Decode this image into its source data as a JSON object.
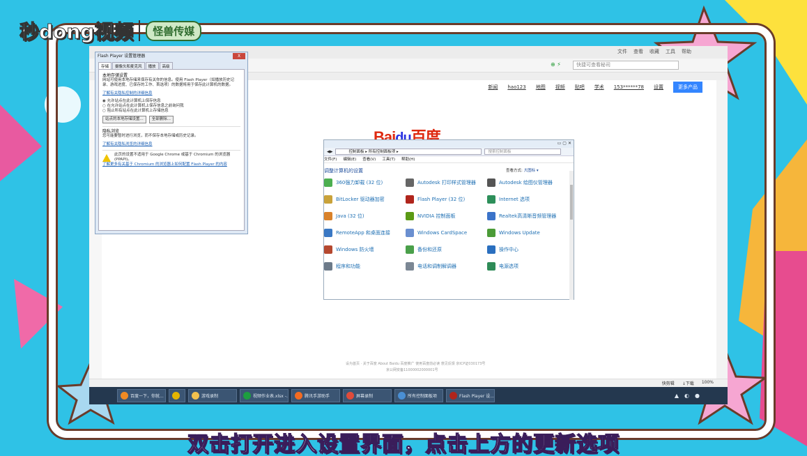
{
  "brand": {
    "name": "秒dong视频",
    "partner": "怪兽传媒"
  },
  "subtitle": "双击打开进入设置界面，点击上方的更新选项",
  "browser": {
    "window_menu": [
      "文件",
      "查看",
      "收藏",
      "工具",
      "帮助"
    ],
    "search_placeholder": "快捷可查看秘司",
    "nav_links": [
      "新闻",
      "hao123",
      "地图",
      "视频",
      "贴吧",
      "学术",
      "153******78",
      "设置"
    ],
    "more_button": "更多产品",
    "logo_left": "Bai",
    "logo_paw": "du",
    "logo_right": "百度",
    "footer_line1": "设为首页 · 关于百度 About Baidu 百度推广 使用百度前必读 意见反馈 京ICP证030173号",
    "footer_line2": "京公网安备11000002000001号",
    "status_items": [
      "快剪辑",
      "↓下载",
      "100%"
    ]
  },
  "taskbar": {
    "tasks": [
      {
        "label": "百度一下，你就...",
        "color": "#f08a24"
      },
      {
        "label": "",
        "color": "#e3b400"
      },
      {
        "label": "游戏录制",
        "color": "#f2c14e"
      },
      {
        "label": "视频作业表.xlsx -...",
        "color": "#1d9d3f"
      },
      {
        "label": "腾讯手游助手",
        "color": "#f36b21"
      },
      {
        "label": "屏幕录制",
        "color": "#e04b3a"
      },
      {
        "label": "所有控制面板项",
        "color": "#4a8fd4"
      },
      {
        "label": "Flash Player 设...",
        "color": "#b0251c"
      }
    ]
  },
  "flash_dialog": {
    "title": "Flash Player 设置管理器",
    "close": "X",
    "tabs": [
      "存储",
      "摄像头和麦克风",
      "播放",
      "高级"
    ],
    "active_tab": 0,
    "section_local": "本地存储设置",
    "desc": "网站可使用本地存储来保存有关你的信息。使用 Flash Player（如播放历史记录、游戏进度、已保存的工作、首选项）的数据将用于保存此计算机的数据。",
    "link_learn": "了解有关隐私控制的详细信息",
    "options": [
      "允许站点在此计算机上保存信息",
      "在允许站点在此计算机上保存信息之前询问我",
      "阻止所有站点在此计算机上存储信息"
    ],
    "btn_site": "站点的本地存储设置...",
    "btn_delete": "全部删除...",
    "section_private": "隐私浏览",
    "private_desc": "您可能要暂时进行浏览，而不保存本地存储或历史记录。",
    "link_private": "了解有关隐私浏览的详细信息",
    "warn_text": "此页的设置不适用于 Google Chrome 或基于 Chromium 的浏览器 (PPAPI)。",
    "link_chromium": "了解更多有关基于 Chromium 的浏览器上如何配置 Flash Player 的内容"
  },
  "control_panel": {
    "path": "控制面板 ▸ 所有控制面板项 ▸",
    "search_placeholder": "搜索控制面板",
    "menu": [
      "文件(F)",
      "编辑(E)",
      "查看(V)",
      "工具(T)",
      "帮助(H)"
    ],
    "heading": "调整计算机的设置",
    "view_label": "查看方式:",
    "view_value": "大图标 ▾",
    "items": [
      {
        "label": "360强力卸载 (32 位)",
        "icon": "uninstall-icon",
        "color": "#4caf50"
      },
      {
        "label": "Autodesk 打印样式管理器",
        "icon": "printer-icon",
        "color": "#666"
      },
      {
        "label": "Autodesk 绘图仪管理器",
        "icon": "plotter-icon",
        "color": "#555"
      },
      {
        "label": "BitLocker 驱动器加密",
        "icon": "bitlocker-icon",
        "color": "#c9a23a"
      },
      {
        "label": "Flash Player (32 位)",
        "icon": "flash-icon",
        "color": "#b0251c"
      },
      {
        "label": "Internet 选项",
        "icon": "internet-icon",
        "color": "#2d8f5a"
      },
      {
        "label": "Java (32 位)",
        "icon": "java-icon",
        "color": "#d9822b"
      },
      {
        "label": "NVIDIA 控制面板",
        "icon": "nvidia-icon",
        "color": "#5b9a15"
      },
      {
        "label": "Realtek高清晰音频管理器",
        "icon": "audio-icon",
        "color": "#3b73c9"
      },
      {
        "label": "RemoteApp 和桌面连接",
        "icon": "remote-icon",
        "color": "#3a78c4"
      },
      {
        "label": "Windows CardSpace",
        "icon": "cardspace-icon",
        "color": "#6a8fd0"
      },
      {
        "label": "Windows Update",
        "icon": "update-icon",
        "color": "#4b9b37"
      },
      {
        "label": "Windows 防火墙",
        "icon": "firewall-icon",
        "color": "#b5482f"
      },
      {
        "label": "备份和还原",
        "icon": "backup-icon",
        "color": "#4aa04a"
      },
      {
        "label": "操作中心",
        "icon": "flag-icon",
        "color": "#2a6fbf"
      },
      {
        "label": "程序和功能",
        "icon": "programs-icon",
        "color": "#6c7a89"
      },
      {
        "label": "电话和调制解调器",
        "icon": "phone-icon",
        "color": "#7b8794"
      },
      {
        "label": "电源选项",
        "icon": "power-icon",
        "color": "#2e8b57"
      }
    ]
  }
}
